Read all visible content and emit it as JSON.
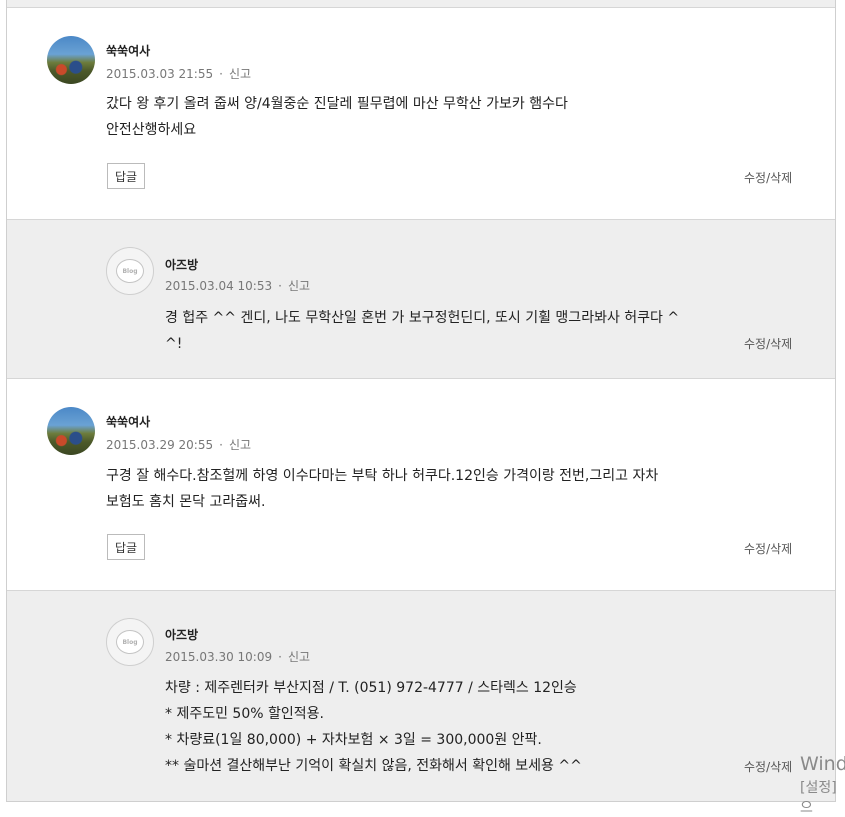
{
  "comments": [
    {
      "name": "쑥쑥여사",
      "date": "2015.03.03 21:55",
      "sep": "·",
      "report": "신고",
      "body": "갔다 왕 후기 올려 줍써 양/4월중순 진달레 필무렵에 마산 무학산 가보카 햄수다\n안전산행하세요",
      "reply_label": "답글",
      "edit_label": "수정/삭제"
    },
    {
      "name": "아즈방",
      "date": "2015.03.04 10:53",
      "sep": "·",
      "report": "신고",
      "body": "경 헙주 ^^ 겐디, 나도 무학산일 혼번 가 보구정헌딘디, 또시 기휠 맹그라봐사 허쿠다 ^\n^!",
      "edit_label": "수정/삭제",
      "avatar_text": "Blog"
    },
    {
      "name": "쑥쑥여사",
      "date": "2015.03.29 20:55",
      "sep": "·",
      "report": "신고",
      "body": "구경 잘 해수다.참조헐께 하영 이수다마는 부탁 하나 허쿠다.12인승 가격이랑 전번,그리고 자차\n보험도 홈치 몬닥 고라줍써.",
      "reply_label": "답글",
      "edit_label": "수정/삭제"
    },
    {
      "name": "아즈방",
      "date": "2015.03.30 10:09",
      "sep": "·",
      "report": "신고",
      "body": "차량 : 제주렌터카 부산지점 / T. (051) 972-4777 / 스타렉스 12인승\n* 제주도민 50% 할인적용.\n* 차량료(1일 80,000) + 자차보험 × 3일 = 300,000원 안팍.\n** 술마션 결산해부난 기억이 확실치 않음, 전화해서 확인해 보세용 ^^",
      "edit_label": "수정/삭제",
      "avatar_text": "Blog"
    }
  ],
  "watermark": {
    "line1": "Wind",
    "line2": "[설정]으"
  }
}
